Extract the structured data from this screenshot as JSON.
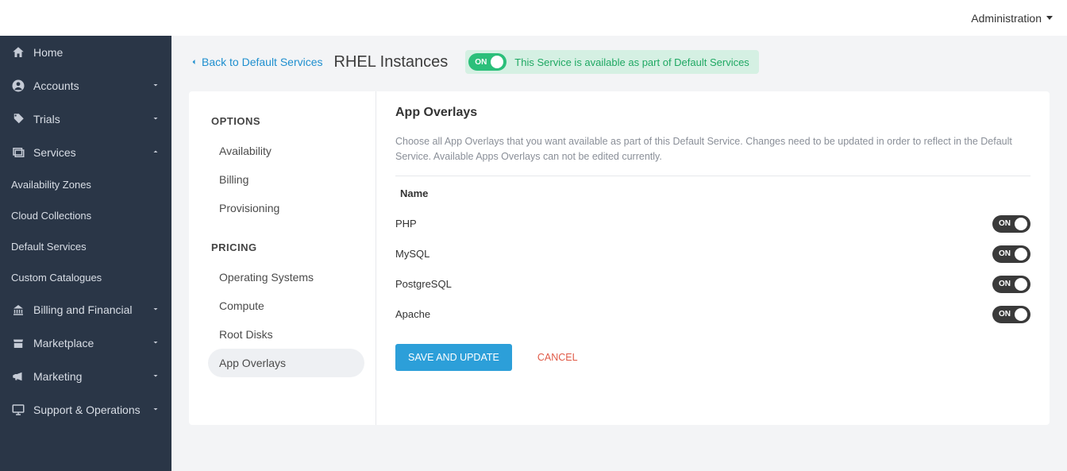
{
  "topbar": {
    "admin_label": "Administration"
  },
  "sidebar": {
    "home": "Home",
    "accounts": "Accounts",
    "trials": "Trials",
    "services": "Services",
    "services_children": {
      "availability_zones": "Availability Zones",
      "cloud_collections": "Cloud Collections",
      "default_services": "Default Services",
      "custom_catalogues": "Custom Catalogues"
    },
    "billing": "Billing and Financial",
    "marketplace": "Marketplace",
    "marketing": "Marketing",
    "support_ops": "Support & Operations"
  },
  "header": {
    "back_label": "Back to Default Services",
    "title": "RHEL Instances",
    "toggle_on_label": "ON",
    "availability_text": "This Service is available as part of Default Services"
  },
  "left_panel": {
    "options_head": "OPTIONS",
    "pricing_head": "PRICING",
    "options": {
      "availability": "Availability",
      "billing": "Billing",
      "provisioning": "Provisioning"
    },
    "pricing": {
      "operating_systems": "Operating Systems",
      "compute": "Compute",
      "root_disks": "Root Disks",
      "app_overlays": "App Overlays"
    }
  },
  "panel": {
    "title": "App Overlays",
    "description": "Choose all App Overlays that you want available as part of this Default Service. Changes need to be updated in order to reflect in the Default Service. Available Apps Overlays can not be edited currently.",
    "col_name": "Name",
    "rows": [
      {
        "name": "PHP"
      },
      {
        "name": "MySQL"
      },
      {
        "name": "PostgreSQL"
      },
      {
        "name": "Apache"
      }
    ],
    "toggle_on_label": "ON",
    "save_label": "SAVE AND UPDATE",
    "cancel_label": "CANCEL"
  }
}
